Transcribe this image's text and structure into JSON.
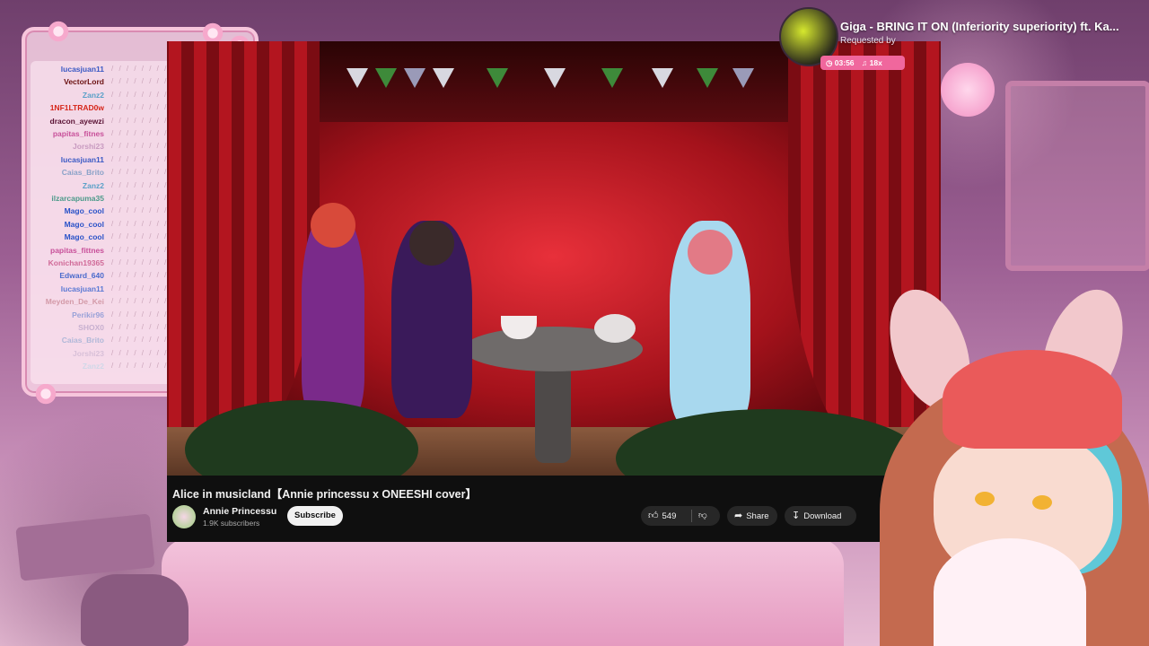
{
  "chat": {
    "users": [
      {
        "name": "lucasjuan11",
        "color": "#3a59c4"
      },
      {
        "name": "VectorLord",
        "color": "#6a1010"
      },
      {
        "name": "Zanz2",
        "color": "#5aa0c8"
      },
      {
        "name": "1NF1LTRAD0w",
        "color": "#d6261a"
      },
      {
        "name": "dracon_ayewzi",
        "color": "#5a1234"
      },
      {
        "name": "papitas_fitnes",
        "color": "#c8509a"
      },
      {
        "name": "Jorshi23",
        "color": "#c89ac0"
      },
      {
        "name": "lucasjuan11",
        "color": "#3a59c4"
      },
      {
        "name": "Caias_Brito",
        "color": "#8aa2c8"
      },
      {
        "name": "Zanz2",
        "color": "#5aa0c8"
      },
      {
        "name": "ilzarcapuma35",
        "color": "#4c9a8a"
      },
      {
        "name": "Mago_cool",
        "color": "#2a52c8"
      },
      {
        "name": "Mago_cool",
        "color": "#2a52c8"
      },
      {
        "name": "Mago_cool",
        "color": "#2a52c8"
      },
      {
        "name": "papitas_fittnes",
        "color": "#c8509a"
      },
      {
        "name": "Konichan19365",
        "color": "#d06a98"
      },
      {
        "name": "Edward_640",
        "color": "#4a6acc"
      },
      {
        "name": "lucasjuan11",
        "color": "#5a79d4"
      },
      {
        "name": "Meyden_De_Kei",
        "color": "#d39aa8"
      },
      {
        "name": "Perikir96",
        "color": "#9aa2d8"
      },
      {
        "name": "SHOX0",
        "color": "#c8b0d0"
      },
      {
        "name": "Caias_Brito",
        "color": "#b0b8d8"
      },
      {
        "name": "Jorshi23",
        "color": "#d8c0d8"
      },
      {
        "name": "Zanz2",
        "color": "#d0d8e8"
      }
    ],
    "message_glyphs": "/ / / / / / / / /"
  },
  "video": {
    "title": "Alice in musicland【Annie princessu x ONEESHI cover】",
    "channel_name": "Annie Princessu",
    "subscribers": "1.9K subscribers",
    "subscribe_label": "Subscribe",
    "like_count": "549",
    "share_label": "Share",
    "download_label": "Download"
  },
  "now_playing": {
    "title": "Giga - BRING IT ON (Inferiority superiority) ft. Ka...",
    "requested_by": "Requested by",
    "time": "03:56",
    "plays": "18x"
  },
  "colors": {
    "accent_pink": "#f0679d",
    "youtube_dark": "#0f0f0f",
    "curtain_red": "#b3151f"
  },
  "icons": {
    "like": "thumbs-up-icon",
    "dislike": "thumbs-down-icon",
    "share": "share-arrow-icon",
    "download": "download-icon",
    "clock": "clock-icon",
    "music": "music-note-icon"
  }
}
